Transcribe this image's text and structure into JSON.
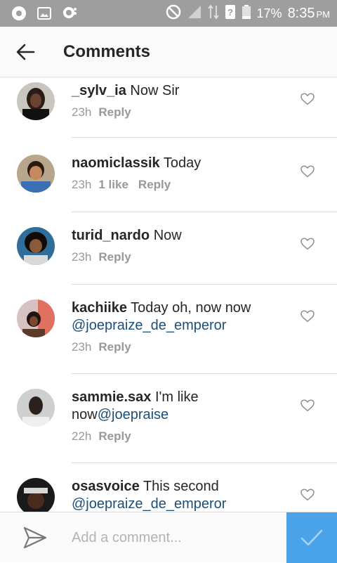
{
  "status_bar": {
    "battery_percent": "17%",
    "time": "8:35",
    "ampm": "PM",
    "icons": [
      "chrome-icon",
      "gallery-icon",
      "whatsapp-icon",
      "no-sim-icon",
      "signal-icon",
      "data-icon",
      "unknown-sim-icon",
      "battery-icon"
    ]
  },
  "header": {
    "title": "Comments",
    "back_icon": "arrow-left-icon"
  },
  "comments": [
    {
      "username": "_sylv_ia",
      "text": "Now Sir",
      "mention": "",
      "time": "23h",
      "likes": "",
      "reply": "Reply"
    },
    {
      "username": "naomiclassik",
      "text": "Today",
      "mention": "",
      "time": "23h",
      "likes": "1 like",
      "reply": "Reply"
    },
    {
      "username": "turid_nardo",
      "text": "Now",
      "mention": "",
      "time": "23h",
      "likes": "",
      "reply": "Reply"
    },
    {
      "username": "kachiike",
      "text": "Today oh, now now",
      "mention": "@joepraize_de_emperor",
      "time": "23h",
      "likes": "",
      "reply": "Reply"
    },
    {
      "username": "sammie.sax",
      "text": "I'm like now",
      "mention": "@joepraise",
      "time": "22h",
      "likes": "",
      "reply": "Reply"
    },
    {
      "username": "osasvoice",
      "text": "This second",
      "mention": "@joepraize_de_emperor",
      "time": "",
      "likes": "",
      "reply": ""
    }
  ],
  "composer": {
    "placeholder": "Add a comment...",
    "value": "",
    "post_icon": "checkmark-icon",
    "send_icon": "direct-send-icon"
  },
  "colors": {
    "accent": "#4aa3e8",
    "mention": "#1b4f7a",
    "meta": "#999999",
    "status_bar": "#9e9e9e"
  }
}
